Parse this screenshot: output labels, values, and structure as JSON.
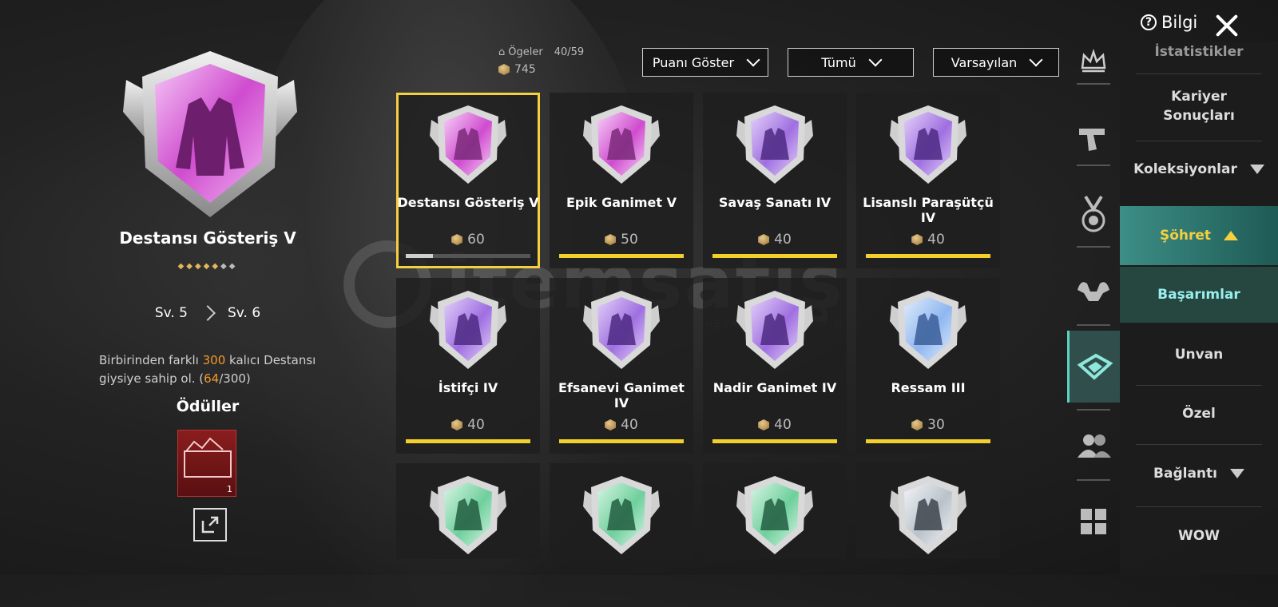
{
  "header": {
    "info_label": "Bilgi",
    "items_label": "Ögeler",
    "items_count": "40/59",
    "points_total": "745",
    "filters": [
      "Puanı Göster",
      "Tümü",
      "Varsayılan"
    ]
  },
  "detail": {
    "title": "Destansı Gösteriş V",
    "stars_filled": 5,
    "stars_total": 7,
    "level_from": "Sv. 5",
    "level_to": "Sv. 6",
    "desc_before": "Birbirinden farklı ",
    "desc_target": "300",
    "desc_middle": " kalıcı Destansı giysiye sahip ol. (",
    "desc_progress": "64",
    "desc_after": "/300)",
    "rewards_title": "Ödüller",
    "reward_count": "1"
  },
  "achievements": [
    {
      "name": "Destansı Gösteriş V",
      "points": "60",
      "tier": "epic",
      "symbol": "jacket",
      "progress": 0.22,
      "selected": true
    },
    {
      "name": "Epik Ganimet V",
      "points": "50",
      "tier": "epic",
      "symbol": "coat",
      "progress": 1
    },
    {
      "name": "Savaş Sanatı IV",
      "points": "40",
      "tier": "purple",
      "symbol": "claws",
      "progress": 1
    },
    {
      "name": "Lisanslı Paraşütçü IV",
      "points": "40",
      "tier": "purple",
      "symbol": "parachute",
      "progress": 1
    },
    {
      "name": "İstifçi IV",
      "points": "40",
      "tier": "purple",
      "symbol": "locker",
      "progress": 1
    },
    {
      "name": "Efsanevi Ganimet IV",
      "points": "40",
      "tier": "purple",
      "symbol": "robe",
      "progress": 1
    },
    {
      "name": "Nadir Ganimet IV",
      "points": "40",
      "tier": "purple",
      "symbol": "coat",
      "progress": 1
    },
    {
      "name": "Ressam III",
      "points": "30",
      "tier": "blue",
      "symbol": "crosshair",
      "progress": 1
    },
    {
      "name": "",
      "points": "",
      "tier": "green",
      "symbol": "dancer",
      "progress": null
    },
    {
      "name": "",
      "points": "",
      "tier": "green",
      "symbol": "dancer2",
      "progress": null
    },
    {
      "name": "",
      "points": "",
      "tier": "green",
      "symbol": "diver",
      "progress": null
    },
    {
      "name": "",
      "points": "",
      "tier": "silver",
      "symbol": "eagle",
      "progress": null
    }
  ],
  "menu": {
    "items": [
      {
        "label": "İstatistikler",
        "type": "normal"
      },
      {
        "label": "Kariyer Sonuçları",
        "type": "normal"
      },
      {
        "label": "Koleksiyonlar",
        "type": "dropdown"
      },
      {
        "label": "Şöhret",
        "type": "active"
      },
      {
        "label": "Başarımlar",
        "type": "sub"
      },
      {
        "label": "Unvan",
        "type": "normal"
      },
      {
        "label": "Özel",
        "type": "normal"
      },
      {
        "label": "Bağlantı",
        "type": "dropdown"
      },
      {
        "label": "WOW",
        "type": "normal"
      }
    ]
  },
  "side_icons": [
    "crown-icon",
    "pistol-icon",
    "medal-icon",
    "muscle-icon",
    "badge-icon",
    "friends-icon",
    "grid-icon"
  ],
  "watermark": {
    "text": "itemsatış",
    "subtext": "HESAP / İTEM / E-PİN"
  },
  "colors": {
    "epic": "#d65bd6",
    "purple": "#a77be0",
    "blue": "#8fb7f0",
    "green": "#7fd6a6",
    "silver": "#c9cfd6",
    "accent": "#f2cf2a",
    "active_menu": "#3c8e86"
  }
}
